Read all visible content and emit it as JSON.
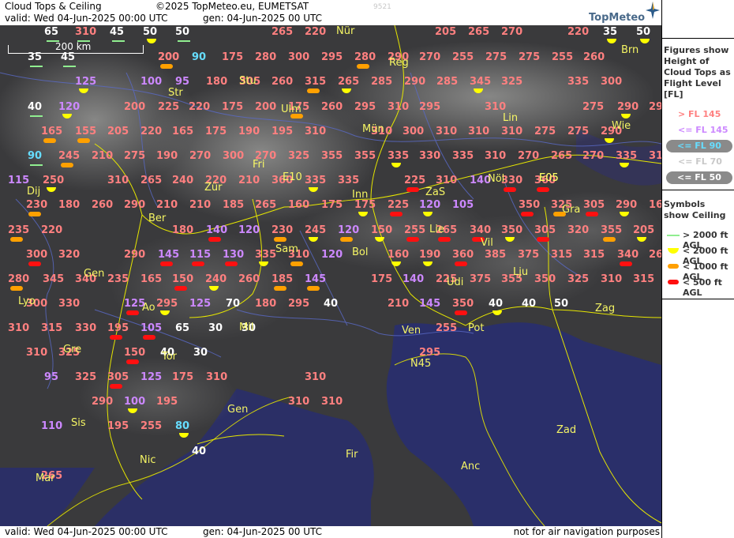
{
  "header": {
    "title": "Cloud Tops & Ceiling",
    "copyright": "©2025 TopMeteo.eu, EUMETSAT",
    "valid": "valid:  Wed  04-Jun-2025  00:00 UTC",
    "generated": "gen: 04-Jun-2025 00 UTC",
    "code": "9521",
    "logo_text": "TopMeteo"
  },
  "footer": {
    "valid": "valid:  Wed  04-Jun-2025  00:00 UTC",
    "generated": "gen:  04-Jun-2025 00 UTC",
    "note": "not for air navigation purposes"
  },
  "map": {
    "scale_label": "200 km",
    "colors": {
      "fl_above_145": "#ff8080",
      "fl_below_145": "#cc88ff",
      "fl_below_90": "#66ddff",
      "fl_below_70": "#ffffff",
      "fl_below_50": "#ffffff",
      "ceiling_2000_plus": "#90ee90",
      "ceiling_below_2000": "#ffff00",
      "ceiling_below_1000": "#ffa000",
      "ceiling_below_500": "#ff1010",
      "city": "#ffff66",
      "land": "#3a3a3c",
      "sea": "#2a2f6a"
    },
    "cities": [
      "Nür",
      "Brn",
      "Reg",
      "Stu",
      "Str",
      "Ulm",
      "Lin",
      "Mün",
      "Wie",
      "Fri",
      "E10",
      "Inn",
      "ZaS",
      "Nöl",
      "E05",
      "Dij",
      "Zür",
      "Gra",
      "Ber",
      "Lie",
      "Vil",
      "Sam",
      "Bol",
      "Lju",
      "Gen",
      "Udi",
      "Lyo",
      "Ao",
      "Zag",
      "Mil",
      "Ven",
      "Pot",
      "Gre",
      "Tor",
      "N45",
      "Sis",
      "Gen",
      "Zad",
      "Nic",
      "Fir",
      "Mar",
      "Anc",
      "E05"
    ],
    "labels": [
      {
        "v": "65",
        "c": "lt50",
        "s": "green"
      },
      {
        "v": "310",
        "c": "hi",
        "s": "green"
      },
      {
        "v": "45",
        "c": "lt50",
        "s": "green"
      },
      {
        "v": "50",
        "c": "lt50",
        "s": "yellow"
      },
      {
        "v": "50",
        "c": "lt50",
        "s": "green"
      },
      {
        "v": "265",
        "c": "hi",
        "s": ""
      },
      {
        "v": "220",
        "c": "hi",
        "s": ""
      },
      {
        "v": "205",
        "c": "hi",
        "s": ""
      },
      {
        "v": "265",
        "c": "hi",
        "s": ""
      },
      {
        "v": "270",
        "c": "hi",
        "s": ""
      },
      {
        "v": "220",
        "c": "hi",
        "s": ""
      },
      {
        "v": "35",
        "c": "lt50",
        "s": "yellow"
      },
      {
        "v": "50",
        "c": "lt50",
        "s": "yellow"
      },
      {
        "v": "35",
        "c": "lt50",
        "s": "green"
      },
      {
        "v": "45",
        "c": "lt50",
        "s": "green"
      },
      {
        "v": "200",
        "c": "hi",
        "s": "orange"
      },
      {
        "v": "200",
        "c": "hi",
        "s": ""
      },
      {
        "v": "90",
        "c": "lt90",
        "s": ""
      },
      {
        "v": "175",
        "c": "hi",
        "s": ""
      },
      {
        "v": "280",
        "c": "hi",
        "s": ""
      },
      {
        "v": "300",
        "c": "hi",
        "s": ""
      },
      {
        "v": "295",
        "c": "hi",
        "s": ""
      },
      {
        "v": "280",
        "c": "hi",
        "s": "orange"
      },
      {
        "v": "290",
        "c": "hi",
        "s": ""
      },
      {
        "v": "270",
        "c": "hi",
        "s": ""
      },
      {
        "v": "255",
        "c": "hi",
        "s": ""
      },
      {
        "v": "275",
        "c": "hi",
        "s": ""
      },
      {
        "v": "275",
        "c": "hi",
        "s": ""
      },
      {
        "v": "255",
        "c": "hi",
        "s": ""
      },
      {
        "v": "260",
        "c": "hi",
        "s": ""
      },
      {
        "v": "125",
        "c": "lo",
        "s": "yellow"
      },
      {
        "v": "100",
        "c": "lo",
        "s": ""
      },
      {
        "v": "95",
        "c": "lo",
        "s": ""
      },
      {
        "v": "180",
        "c": "hi",
        "s": ""
      },
      {
        "v": "305",
        "c": "hi",
        "s": ""
      },
      {
        "v": "260",
        "c": "hi",
        "s": ""
      },
      {
        "v": "315",
        "c": "hi",
        "s": "orange"
      },
      {
        "v": "265",
        "c": "hi",
        "s": "yellow"
      },
      {
        "v": "285",
        "c": "hi",
        "s": ""
      },
      {
        "v": "290",
        "c": "hi",
        "s": ""
      },
      {
        "v": "285",
        "c": "hi",
        "s": ""
      },
      {
        "v": "345",
        "c": "hi",
        "s": "yellow"
      },
      {
        "v": "325",
        "c": "hi",
        "s": ""
      },
      {
        "v": "335",
        "c": "hi",
        "s": ""
      },
      {
        "v": "300",
        "c": "hi",
        "s": ""
      },
      {
        "v": "40",
        "c": "lt50",
        "s": "green"
      },
      {
        "v": "120",
        "c": "lo",
        "s": "yellow"
      },
      {
        "v": "200",
        "c": "hi",
        "s": ""
      },
      {
        "v": "225",
        "c": "hi",
        "s": ""
      },
      {
        "v": "220",
        "c": "hi",
        "s": ""
      },
      {
        "v": "175",
        "c": "hi",
        "s": ""
      },
      {
        "v": "200",
        "c": "hi",
        "s": ""
      },
      {
        "v": "175",
        "c": "hi",
        "s": "orange"
      },
      {
        "v": "260",
        "c": "hi",
        "s": ""
      },
      {
        "v": "295",
        "c": "hi",
        "s": ""
      },
      {
        "v": "310",
        "c": "hi",
        "s": ""
      },
      {
        "v": "295",
        "c": "hi",
        "s": ""
      },
      {
        "v": "310",
        "c": "hi",
        "s": ""
      },
      {
        "v": "275",
        "c": "hi",
        "s": ""
      },
      {
        "v": "290",
        "c": "hi",
        "s": "yellow"
      },
      {
        "v": "29",
        "c": "hi",
        "s": ""
      },
      {
        "v": "165",
        "c": "hi",
        "s": "orange"
      },
      {
        "v": "155",
        "c": "hi",
        "s": "orange"
      },
      {
        "v": "205",
        "c": "hi",
        "s": ""
      },
      {
        "v": "220",
        "c": "hi",
        "s": ""
      },
      {
        "v": "165",
        "c": "hi",
        "s": ""
      },
      {
        "v": "175",
        "c": "hi",
        "s": ""
      },
      {
        "v": "190",
        "c": "hi",
        "s": ""
      },
      {
        "v": "195",
        "c": "hi",
        "s": ""
      },
      {
        "v": "310",
        "c": "hi",
        "s": ""
      },
      {
        "v": "310",
        "c": "hi",
        "s": ""
      },
      {
        "v": "300",
        "c": "hi",
        "s": ""
      },
      {
        "v": "310",
        "c": "hi",
        "s": ""
      },
      {
        "v": "310",
        "c": "hi",
        "s": ""
      },
      {
        "v": "310",
        "c": "hi",
        "s": ""
      },
      {
        "v": "275",
        "c": "hi",
        "s": ""
      },
      {
        "v": "275",
        "c": "hi",
        "s": ""
      },
      {
        "v": "290",
        "c": "hi",
        "s": "yellow"
      },
      {
        "v": "90",
        "c": "lt90",
        "s": "green"
      },
      {
        "v": "245",
        "c": "hi",
        "s": "orange"
      },
      {
        "v": "210",
        "c": "hi",
        "s": ""
      },
      {
        "v": "275",
        "c": "hi",
        "s": ""
      },
      {
        "v": "190",
        "c": "hi",
        "s": ""
      },
      {
        "v": "270",
        "c": "hi",
        "s": ""
      },
      {
        "v": "300",
        "c": "hi",
        "s": ""
      },
      {
        "v": "270",
        "c": "hi",
        "s": ""
      },
      {
        "v": "325",
        "c": "hi",
        "s": ""
      },
      {
        "v": "355",
        "c": "hi",
        "s": ""
      },
      {
        "v": "355",
        "c": "hi",
        "s": ""
      },
      {
        "v": "335",
        "c": "hi",
        "s": "yellow"
      },
      {
        "v": "330",
        "c": "hi",
        "s": ""
      },
      {
        "v": "335",
        "c": "hi",
        "s": ""
      },
      {
        "v": "310",
        "c": "hi",
        "s": ""
      },
      {
        "v": "270",
        "c": "hi",
        "s": ""
      },
      {
        "v": "265",
        "c": "hi",
        "s": ""
      },
      {
        "v": "270",
        "c": "hi",
        "s": ""
      },
      {
        "v": "335",
        "c": "hi",
        "s": "yellow"
      },
      {
        "v": "31",
        "c": "hi",
        "s": ""
      },
      {
        "v": "115",
        "c": "lo",
        "s": ""
      },
      {
        "v": "250",
        "c": "hi",
        "s": "yellow"
      },
      {
        "v": "310",
        "c": "hi",
        "s": ""
      },
      {
        "v": "265",
        "c": "hi",
        "s": ""
      },
      {
        "v": "240",
        "c": "hi",
        "s": ""
      },
      {
        "v": "220",
        "c": "hi",
        "s": ""
      },
      {
        "v": "210",
        "c": "hi",
        "s": ""
      },
      {
        "v": "360",
        "c": "hi",
        "s": ""
      },
      {
        "v": "335",
        "c": "hi",
        "s": "yellow"
      },
      {
        "v": "335",
        "c": "hi",
        "s": ""
      },
      {
        "v": "225",
        "c": "hi",
        "s": "red"
      },
      {
        "v": "310",
        "c": "hi",
        "s": ""
      },
      {
        "v": "140",
        "c": "lo",
        "s": ""
      },
      {
        "v": "330",
        "c": "hi",
        "s": "red"
      },
      {
        "v": "360",
        "c": "hi",
        "s": "red"
      },
      {
        "v": "230",
        "c": "hi",
        "s": "orange"
      },
      {
        "v": "180",
        "c": "hi",
        "s": ""
      },
      {
        "v": "260",
        "c": "hi",
        "s": ""
      },
      {
        "v": "290",
        "c": "hi",
        "s": ""
      },
      {
        "v": "210",
        "c": "hi",
        "s": ""
      },
      {
        "v": "210",
        "c": "hi",
        "s": ""
      },
      {
        "v": "185",
        "c": "hi",
        "s": ""
      },
      {
        "v": "265",
        "c": "hi",
        "s": ""
      },
      {
        "v": "160",
        "c": "hi",
        "s": ""
      },
      {
        "v": "175",
        "c": "hi",
        "s": ""
      },
      {
        "v": "175",
        "c": "hi",
        "s": "yellow"
      },
      {
        "v": "225",
        "c": "hi",
        "s": "red"
      },
      {
        "v": "120",
        "c": "lo",
        "s": "yellow"
      },
      {
        "v": "105",
        "c": "lo",
        "s": ""
      },
      {
        "v": "350",
        "c": "hi",
        "s": "red"
      },
      {
        "v": "325",
        "c": "hi",
        "s": "orange"
      },
      {
        "v": "305",
        "c": "hi",
        "s": "red"
      },
      {
        "v": "290",
        "c": "hi",
        "s": "yellow"
      },
      {
        "v": "16",
        "c": "hi",
        "s": ""
      },
      {
        "v": "235",
        "c": "hi",
        "s": "orange"
      },
      {
        "v": "220",
        "c": "hi",
        "s": ""
      },
      {
        "v": "180",
        "c": "hi",
        "s": ""
      },
      {
        "v": "140",
        "c": "lo",
        "s": "red"
      },
      {
        "v": "120",
        "c": "lo",
        "s": ""
      },
      {
        "v": "230",
        "c": "hi",
        "s": "orange"
      },
      {
        "v": "245",
        "c": "hi",
        "s": "yellow"
      },
      {
        "v": "120",
        "c": "lo",
        "s": "orange"
      },
      {
        "v": "150",
        "c": "hi",
        "s": "yellow"
      },
      {
        "v": "255",
        "c": "hi",
        "s": "red"
      },
      {
        "v": "265",
        "c": "hi",
        "s": "red"
      },
      {
        "v": "340",
        "c": "hi",
        "s": "red"
      },
      {
        "v": "350",
        "c": "hi",
        "s": "yellow"
      },
      {
        "v": "305",
        "c": "hi",
        "s": "red"
      },
      {
        "v": "320",
        "c": "hi",
        "s": ""
      },
      {
        "v": "355",
        "c": "hi",
        "s": "orange"
      },
      {
        "v": "205",
        "c": "hi",
        "s": "yellow"
      },
      {
        "v": "300",
        "c": "hi",
        "s": "red"
      },
      {
        "v": "320",
        "c": "hi",
        "s": ""
      },
      {
        "v": "290",
        "c": "hi",
        "s": ""
      },
      {
        "v": "145",
        "c": "lo",
        "s": "red"
      },
      {
        "v": "115",
        "c": "lo",
        "s": "red"
      },
      {
        "v": "130",
        "c": "lo",
        "s": "red"
      },
      {
        "v": "335",
        "c": "hi",
        "s": "yellow"
      },
      {
        "v": "310",
        "c": "hi",
        "s": "orange"
      },
      {
        "v": "120",
        "c": "lo",
        "s": ""
      },
      {
        "v": "160",
        "c": "hi",
        "s": "yellow"
      },
      {
        "v": "190",
        "c": "hi",
        "s": "yellow"
      },
      {
        "v": "360",
        "c": "hi",
        "s": "red"
      },
      {
        "v": "385",
        "c": "hi",
        "s": ""
      },
      {
        "v": "375",
        "c": "hi",
        "s": ""
      },
      {
        "v": "315",
        "c": "hi",
        "s": ""
      },
      {
        "v": "315",
        "c": "hi",
        "s": ""
      },
      {
        "v": "340",
        "c": "hi",
        "s": "red"
      },
      {
        "v": "26",
        "c": "hi",
        "s": ""
      },
      {
        "v": "280",
        "c": "hi",
        "s": "orange"
      },
      {
        "v": "345",
        "c": "hi",
        "s": ""
      },
      {
        "v": "340",
        "c": "hi",
        "s": ""
      },
      {
        "v": "235",
        "c": "hi",
        "s": ""
      },
      {
        "v": "165",
        "c": "hi",
        "s": ""
      },
      {
        "v": "150",
        "c": "hi",
        "s": "red"
      },
      {
        "v": "240",
        "c": "hi",
        "s": "yellow"
      },
      {
        "v": "260",
        "c": "hi",
        "s": ""
      },
      {
        "v": "185",
        "c": "hi",
        "s": "orange"
      },
      {
        "v": "145",
        "c": "lo",
        "s": "orange"
      },
      {
        "v": "175",
        "c": "hi",
        "s": ""
      },
      {
        "v": "140",
        "c": "lo",
        "s": ""
      },
      {
        "v": "225",
        "c": "hi",
        "s": ""
      },
      {
        "v": "375",
        "c": "hi",
        "s": ""
      },
      {
        "v": "355",
        "c": "hi",
        "s": ""
      },
      {
        "v": "350",
        "c": "hi",
        "s": ""
      },
      {
        "v": "325",
        "c": "hi",
        "s": ""
      },
      {
        "v": "310",
        "c": "hi",
        "s": ""
      },
      {
        "v": "315",
        "c": "hi",
        "s": ""
      },
      {
        "v": "300",
        "c": "hi",
        "s": ""
      },
      {
        "v": "330",
        "c": "hi",
        "s": ""
      },
      {
        "v": "125",
        "c": "lo",
        "s": "red"
      },
      {
        "v": "295",
        "c": "hi",
        "s": "yellow"
      },
      {
        "v": "125",
        "c": "lo",
        "s": ""
      },
      {
        "v": "70",
        "c": "lt70",
        "s": ""
      },
      {
        "v": "180",
        "c": "hi",
        "s": ""
      },
      {
        "v": "295",
        "c": "hi",
        "s": ""
      },
      {
        "v": "40",
        "c": "lt50",
        "s": ""
      },
      {
        "v": "210",
        "c": "hi",
        "s": ""
      },
      {
        "v": "145",
        "c": "lo",
        "s": ""
      },
      {
        "v": "350",
        "c": "hi",
        "s": "red"
      },
      {
        "v": "40",
        "c": "lt50",
        "s": "yellow"
      },
      {
        "v": "40",
        "c": "lt50",
        "s": ""
      },
      {
        "v": "50",
        "c": "lt50",
        "s": ""
      },
      {
        "v": "310",
        "c": "hi",
        "s": ""
      },
      {
        "v": "315",
        "c": "hi",
        "s": ""
      },
      {
        "v": "330",
        "c": "hi",
        "s": ""
      },
      {
        "v": "195",
        "c": "hi",
        "s": "red"
      },
      {
        "v": "105",
        "c": "lo",
        "s": "red"
      },
      {
        "v": "65",
        "c": "lt70",
        "s": ""
      },
      {
        "v": "30",
        "c": "lt50",
        "s": ""
      },
      {
        "v": "30",
        "c": "lt50",
        "s": ""
      },
      {
        "v": "255",
        "c": "hi",
        "s": ""
      },
      {
        "v": "310",
        "c": "hi",
        "s": ""
      },
      {
        "v": "325",
        "c": "hi",
        "s": ""
      },
      {
        "v": "150",
        "c": "hi",
        "s": "red"
      },
      {
        "v": "40",
        "c": "lt50",
        "s": ""
      },
      {
        "v": "30",
        "c": "lt50",
        "s": ""
      },
      {
        "v": "295",
        "c": "hi",
        "s": ""
      },
      {
        "v": "95",
        "c": "lo",
        "s": ""
      },
      {
        "v": "325",
        "c": "hi",
        "s": ""
      },
      {
        "v": "305",
        "c": "hi",
        "s": "red"
      },
      {
        "v": "125",
        "c": "lo",
        "s": ""
      },
      {
        "v": "175",
        "c": "hi",
        "s": ""
      },
      {
        "v": "310",
        "c": "hi",
        "s": ""
      },
      {
        "v": "310",
        "c": "hi",
        "s": ""
      },
      {
        "v": "290",
        "c": "hi",
        "s": ""
      },
      {
        "v": "100",
        "c": "lo",
        "s": "yellow"
      },
      {
        "v": "195",
        "c": "hi",
        "s": ""
      },
      {
        "v": "310",
        "c": "hi",
        "s": ""
      },
      {
        "v": "310",
        "c": "hi",
        "s": ""
      },
      {
        "v": "110",
        "c": "lo",
        "s": ""
      },
      {
        "v": "195",
        "c": "hi",
        "s": ""
      },
      {
        "v": "255",
        "c": "hi",
        "s": ""
      },
      {
        "v": "80",
        "c": "lt90",
        "s": "yellow"
      },
      {
        "v": "40",
        "c": "lt50",
        "s": ""
      },
      {
        "v": "265",
        "c": "hi",
        "s": ""
      }
    ]
  },
  "legend": {
    "figures_title": "Figures show Height of Cloud Tops as Flight Level  [FL]",
    "fl_items": [
      "> FL 145",
      "<= FL 145",
      "<= FL 90",
      "<= FL 70",
      "<= FL 50"
    ],
    "symbols_title": "Symbols show Ceiling",
    "symbol_items": [
      "> 2000 ft AGL",
      "< 2000 ft AGL",
      "< 1000 ft AGL",
      "< 500 ft AGL"
    ]
  }
}
